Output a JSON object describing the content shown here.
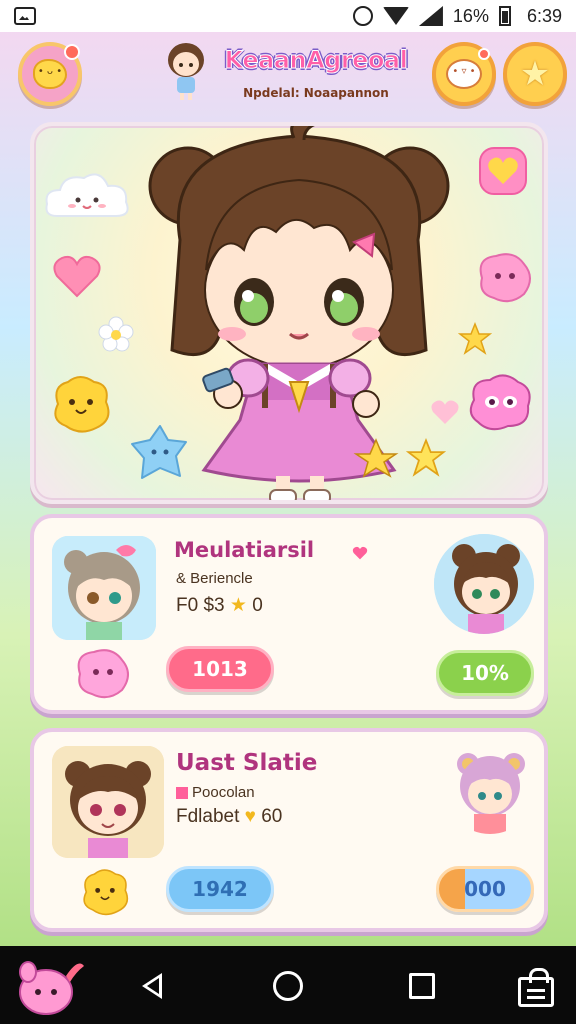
{
  "status_bar": {
    "battery_text": "16%",
    "time": "6:39"
  },
  "header": {
    "title": "KeaanAgreoal",
    "subtitle": "Npdelal: Noaapannon"
  },
  "cards": [
    {
      "title": "Meulatiarsil",
      "line1": "& Beriencle",
      "line2": "F0 $3",
      "line2_suffix": "0",
      "button_left": "1013",
      "button_right": "10%"
    },
    {
      "title": "Uast Slatie",
      "line1": "Poocolan",
      "line2": "Fdlabet",
      "line2_suffix": "60",
      "button_left": "1942",
      "button_right": "000"
    }
  ],
  "colors": {
    "accent_pink": "#ff6b8a",
    "accent_green": "#8bd14c",
    "accent_blue": "#7cc6f7",
    "title_pink": "#ff5fa8"
  },
  "icons": [
    "image-icon",
    "alarm-icon",
    "wifi-icon",
    "signal-icon",
    "battery-icon",
    "star-icon",
    "chat-icon",
    "heart-icon",
    "back-icon",
    "home-icon",
    "recent-apps-icon",
    "shop-icon"
  ]
}
